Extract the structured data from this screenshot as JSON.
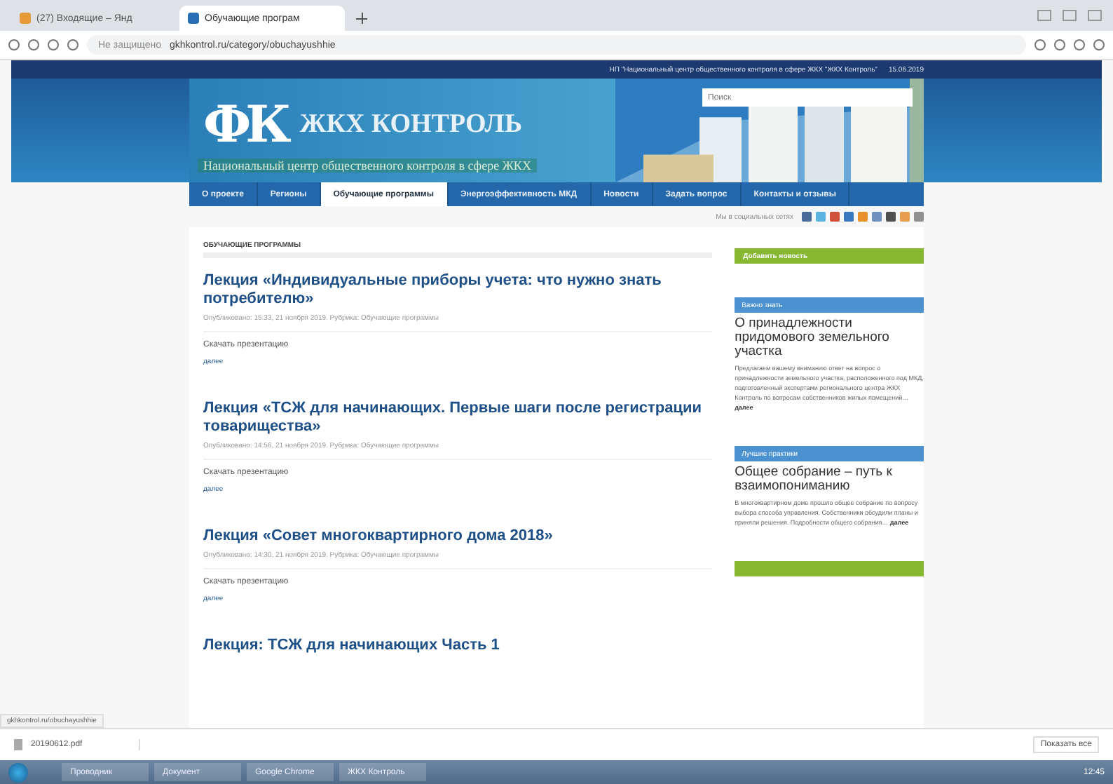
{
  "browser": {
    "tabs": [
      {
        "title": "(27) Входящие – Янд",
        "selected": false
      },
      {
        "title": "Обучающие програм",
        "selected": true
      }
    ],
    "address": {
      "security": "Не защищено",
      "url": "gkhkontrol.ru/category/obuchayushhie"
    }
  },
  "top_strip": {
    "text": "НП \"Национальный центр общественного контроля в сфере ЖКХ \"ЖКХ Контроль\"",
    "date": "15.06.2019"
  },
  "header": {
    "logo": "ФК",
    "title": "ЖКХ КОНТРОЛЬ",
    "subtitle": "Национальный центр общественного контроля в сфере ЖКХ",
    "search": {
      "placeholder": "Поиск"
    }
  },
  "nav": [
    {
      "label": "О проекте",
      "selected": false
    },
    {
      "label": "Регионы",
      "selected": false
    },
    {
      "label": "Обучающие программы",
      "selected": true
    },
    {
      "label": "Энергоэффективность МКД",
      "selected": false
    },
    {
      "label": "Новости",
      "selected": false
    },
    {
      "label": "Задать вопрос",
      "selected": false
    },
    {
      "label": "Контакты и отзывы",
      "selected": false
    }
  ],
  "social": {
    "label": "Мы в социальных сетях",
    "icons": [
      {
        "color": "#4a6a9a"
      },
      {
        "color": "#5bb3e0"
      },
      {
        "color": "#d0503c"
      },
      {
        "color": "#3a78c0"
      },
      {
        "color": "#e8902a"
      },
      {
        "color": "#7090c0"
      },
      {
        "color": "#505050"
      },
      {
        "color": "#e8a050"
      },
      {
        "color": "#909090"
      }
    ]
  },
  "section_title": "ОБУЧАЮЩИЕ ПРОГРАММЫ",
  "posts": [
    {
      "title": "Лекция «Индивидуальные приборы учета: что нужно знать потребителю»",
      "meta": "Опубликовано: 15:33, 21 ноября 2019. Рубрика: Обучающие программы",
      "download": "Скачать презентацию",
      "more": "далее"
    },
    {
      "title": "Лекция «ТСЖ для начинающих. Первые шаги после регистрации товарищества»",
      "meta": "Опубликовано: 14:56, 21 ноября 2019. Рубрика: Обучающие программы",
      "download": "Скачать презентацию",
      "more": "далее"
    },
    {
      "title": "Лекция «Совет многоквартирного дома 2018»",
      "meta": "Опубликовано: 14:30, 21 ноября 2019. Рубрика: Обучающие программы",
      "download": "Скачать презентацию",
      "more": "далее"
    },
    {
      "title": "Лекция: ТСЖ для начинающих Часть 1"
    }
  ],
  "sidebar": [
    {
      "kind": "button",
      "label": "Добавить новость"
    },
    {
      "kind": "article",
      "label": "Важно знать",
      "title": "О принадлежности придомового земельного участка",
      "text": "Предлагаем вашему вниманию ответ на вопрос о принадлежности земельного участка, расположенного под МКД, подготовленный экспертами регионального центра ЖКХ Контроль по вопросам собственников жилых помещений…",
      "more": "далее"
    },
    {
      "kind": "article",
      "label": "Лучшие практики",
      "title": "Общее собрание – путь к взаимопониманию",
      "text": "В многоквартирном доме прошло общее собрание по вопросу выбора способа управления. Собственники обсудили планы и приняли решения. Подробности общего собрания…",
      "more": "далее"
    },
    {
      "kind": "button"
    }
  ],
  "status_url": "gkhkontrol.ru/obuchayushhie",
  "download_bar": {
    "file": "20190612.pdf",
    "show_all": "Показать все"
  },
  "taskbar": [
    {
      "label": "Проводник"
    },
    {
      "label": "Документ"
    },
    {
      "label": "Google Chrome"
    },
    {
      "label": "ЖКХ Контроль"
    }
  ],
  "clock": "12:45"
}
